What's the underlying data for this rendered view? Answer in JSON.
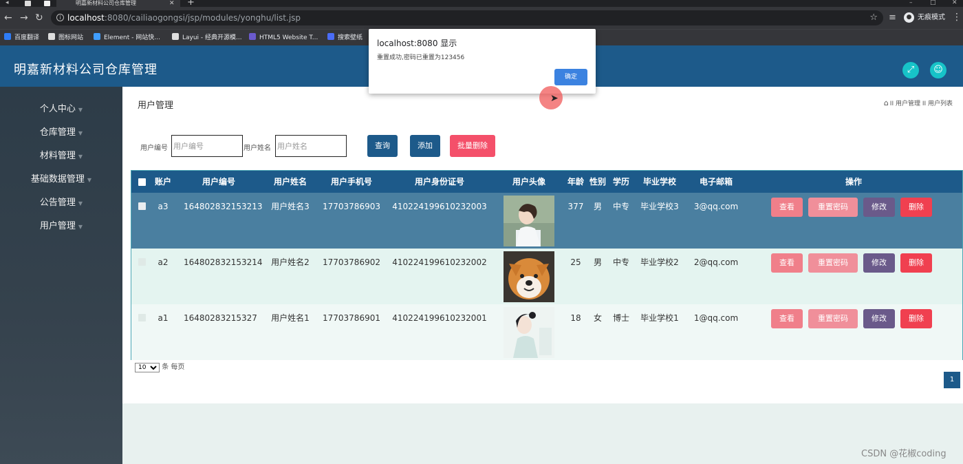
{
  "browser": {
    "tab_title": "明嘉新材料公司仓库管理",
    "url_host": "localhost",
    "url_path": ":8080/cailiaogongsi/jsp/modules/yonghu/list.jsp",
    "incognito_label": "无痕模式",
    "bookmarks": [
      {
        "label": "百度翻译",
        "color": "#2e7cf6"
      },
      {
        "label": "图标网站",
        "color": "#dddddd"
      },
      {
        "label": "Element - 网站快...",
        "color": "#409eff"
      },
      {
        "label": "Layui - 经典开源模...",
        "color": "#dddddd"
      },
      {
        "label": "HTML5 Website T...",
        "color": "#6a5acd"
      },
      {
        "label": "搜索壁纸",
        "color": "#4a6cf7"
      }
    ]
  },
  "app": {
    "title": "明嘉新材料公司仓库管理"
  },
  "sidebar": {
    "items": [
      {
        "label": "个人中心"
      },
      {
        "label": "仓库管理"
      },
      {
        "label": "材料管理"
      },
      {
        "label": "基础数据管理"
      },
      {
        "label": "公告管理"
      },
      {
        "label": "用户管理"
      }
    ]
  },
  "page": {
    "title": "用户管理",
    "breadcrumb": "II 用户管理 II 用户列表"
  },
  "search": {
    "id_label": "用户编号",
    "id_placeholder": "用户编号",
    "name_label": "用户姓名",
    "name_placeholder": "用户姓名",
    "query_label": "查询",
    "add_label": "添加",
    "batch_delete_label": "批量删除"
  },
  "table": {
    "headers": [
      "账户",
      "用户编号",
      "用户姓名",
      "用户手机号",
      "用户身份证号",
      "用户头像",
      "年龄",
      "性别",
      "学历",
      "毕业学校",
      "电子邮箱",
      "操作"
    ],
    "rows": [
      {
        "account": "a3",
        "id": "164802832153213",
        "name": "用户姓名3",
        "phone": "17703786903",
        "idcard": "410224199610232003",
        "age": "377",
        "gender": "男",
        "edu": "中专",
        "school": "毕业学校3",
        "email": "3@qq.com"
      },
      {
        "account": "a2",
        "id": "164802832153214",
        "name": "用户姓名2",
        "phone": "17703786902",
        "idcard": "410224199610232002",
        "age": "25",
        "gender": "男",
        "edu": "中专",
        "school": "毕业学校2",
        "email": "2@qq.com"
      },
      {
        "account": "a1",
        "id": "16480283215327",
        "name": "用户姓名1",
        "phone": "17703786901",
        "idcard": "410224199610232001",
        "age": "18",
        "gender": "女",
        "edu": "博士",
        "school": "毕业学校1",
        "email": "1@qq.com"
      }
    ],
    "actions": {
      "view": "查看",
      "reset": "重置密码",
      "edit": "修改",
      "delete": "删除"
    }
  },
  "pagination": {
    "page_size": "10",
    "per_page_label": "条 每页",
    "current_page": "1"
  },
  "dialog": {
    "title": "localhost:8080 显示",
    "message": "重置成功,密码已重置为123456",
    "ok_label": "确定"
  },
  "watermark": "CSDN @花椒coding",
  "colors": {
    "header": "#1d5a8a",
    "accent_teal": "#17c3c8",
    "batch_delete": "#f4506a",
    "view": "#f07f8a",
    "reset": "#f08f9a",
    "edit": "#6a5a8a",
    "delete": "#f04050"
  }
}
